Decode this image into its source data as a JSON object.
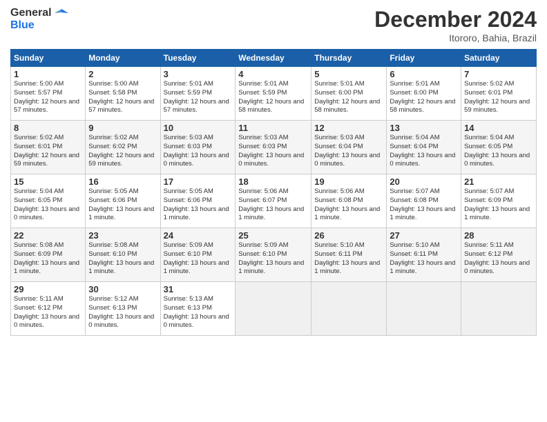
{
  "header": {
    "logo_line1": "General",
    "logo_line2": "Blue",
    "month": "December 2024",
    "location": "Itororo, Bahia, Brazil"
  },
  "days_of_week": [
    "Sunday",
    "Monday",
    "Tuesday",
    "Wednesday",
    "Thursday",
    "Friday",
    "Saturday"
  ],
  "weeks": [
    [
      {
        "num": "1",
        "rise": "5:00 AM",
        "set": "5:57 PM",
        "daylight": "12 hours and 57 minutes."
      },
      {
        "num": "2",
        "rise": "5:00 AM",
        "set": "5:58 PM",
        "daylight": "12 hours and 57 minutes."
      },
      {
        "num": "3",
        "rise": "5:01 AM",
        "set": "5:59 PM",
        "daylight": "12 hours and 57 minutes."
      },
      {
        "num": "4",
        "rise": "5:01 AM",
        "set": "5:59 PM",
        "daylight": "12 hours and 58 minutes."
      },
      {
        "num": "5",
        "rise": "5:01 AM",
        "set": "6:00 PM",
        "daylight": "12 hours and 58 minutes."
      },
      {
        "num": "6",
        "rise": "5:01 AM",
        "set": "6:00 PM",
        "daylight": "12 hours and 58 minutes."
      },
      {
        "num": "7",
        "rise": "5:02 AM",
        "set": "6:01 PM",
        "daylight": "12 hours and 59 minutes."
      }
    ],
    [
      {
        "num": "8",
        "rise": "5:02 AM",
        "set": "6:01 PM",
        "daylight": "12 hours and 59 minutes."
      },
      {
        "num": "9",
        "rise": "5:02 AM",
        "set": "6:02 PM",
        "daylight": "12 hours and 59 minutes."
      },
      {
        "num": "10",
        "rise": "5:03 AM",
        "set": "6:03 PM",
        "daylight": "13 hours and 0 minutes."
      },
      {
        "num": "11",
        "rise": "5:03 AM",
        "set": "6:03 PM",
        "daylight": "13 hours and 0 minutes."
      },
      {
        "num": "12",
        "rise": "5:03 AM",
        "set": "6:04 PM",
        "daylight": "13 hours and 0 minutes."
      },
      {
        "num": "13",
        "rise": "5:04 AM",
        "set": "6:04 PM",
        "daylight": "13 hours and 0 minutes."
      },
      {
        "num": "14",
        "rise": "5:04 AM",
        "set": "6:05 PM",
        "daylight": "13 hours and 0 minutes."
      }
    ],
    [
      {
        "num": "15",
        "rise": "5:04 AM",
        "set": "6:05 PM",
        "daylight": "13 hours and 0 minutes."
      },
      {
        "num": "16",
        "rise": "5:05 AM",
        "set": "6:06 PM",
        "daylight": "13 hours and 1 minute."
      },
      {
        "num": "17",
        "rise": "5:05 AM",
        "set": "6:06 PM",
        "daylight": "13 hours and 1 minute."
      },
      {
        "num": "18",
        "rise": "5:06 AM",
        "set": "6:07 PM",
        "daylight": "13 hours and 1 minute."
      },
      {
        "num": "19",
        "rise": "5:06 AM",
        "set": "6:08 PM",
        "daylight": "13 hours and 1 minute."
      },
      {
        "num": "20",
        "rise": "5:07 AM",
        "set": "6:08 PM",
        "daylight": "13 hours and 1 minute."
      },
      {
        "num": "21",
        "rise": "5:07 AM",
        "set": "6:09 PM",
        "daylight": "13 hours and 1 minute."
      }
    ],
    [
      {
        "num": "22",
        "rise": "5:08 AM",
        "set": "6:09 PM",
        "daylight": "13 hours and 1 minute."
      },
      {
        "num": "23",
        "rise": "5:08 AM",
        "set": "6:10 PM",
        "daylight": "13 hours and 1 minute."
      },
      {
        "num": "24",
        "rise": "5:09 AM",
        "set": "6:10 PM",
        "daylight": "13 hours and 1 minute."
      },
      {
        "num": "25",
        "rise": "5:09 AM",
        "set": "6:10 PM",
        "daylight": "13 hours and 1 minute."
      },
      {
        "num": "26",
        "rise": "5:10 AM",
        "set": "6:11 PM",
        "daylight": "13 hours and 1 minute."
      },
      {
        "num": "27",
        "rise": "5:10 AM",
        "set": "6:11 PM",
        "daylight": "13 hours and 1 minute."
      },
      {
        "num": "28",
        "rise": "5:11 AM",
        "set": "6:12 PM",
        "daylight": "13 hours and 0 minutes."
      }
    ],
    [
      {
        "num": "29",
        "rise": "5:11 AM",
        "set": "6:12 PM",
        "daylight": "13 hours and 0 minutes."
      },
      {
        "num": "30",
        "rise": "5:12 AM",
        "set": "6:13 PM",
        "daylight": "13 hours and 0 minutes."
      },
      {
        "num": "31",
        "rise": "5:13 AM",
        "set": "6:13 PM",
        "daylight": "13 hours and 0 minutes."
      },
      null,
      null,
      null,
      null
    ]
  ]
}
